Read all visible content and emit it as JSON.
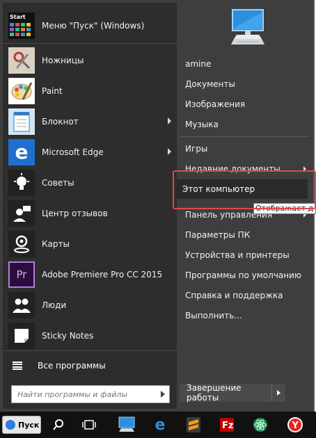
{
  "menu": {
    "header_item": {
      "label": "Меню \"Пуск\" (Windows)",
      "icon": "start-menu-tiles-icon",
      "tile_text": "Start"
    },
    "programs": [
      {
        "label": "Ножницы",
        "icon": "scissors-icon",
        "has_submenu": false
      },
      {
        "label": "Paint",
        "icon": "paint-palette-icon",
        "has_submenu": false
      },
      {
        "label": "Блокнот",
        "icon": "notepad-icon",
        "has_submenu": true
      },
      {
        "label": "Microsoft Edge",
        "icon": "edge-icon",
        "has_submenu": true
      },
      {
        "label": "Советы",
        "icon": "lightbulb-icon",
        "has_submenu": false
      },
      {
        "label": "Центр отзывов",
        "icon": "feedback-icon",
        "has_submenu": false
      },
      {
        "label": "Карты",
        "icon": "maps-icon",
        "has_submenu": false
      },
      {
        "label": "Adobe Premiere Pro CC 2015",
        "icon": "premiere-icon",
        "icon_text": "Pr",
        "has_submenu": false
      },
      {
        "label": "Люди",
        "icon": "people-icon",
        "has_submenu": false
      },
      {
        "label": "Sticky Notes",
        "icon": "sticky-notes-icon",
        "has_submenu": false
      }
    ],
    "all_programs": "Все программы",
    "search": {
      "placeholder": "Найти программы и файлы",
      "value": ""
    }
  },
  "right": {
    "items": [
      {
        "label": "amine",
        "has_submenu": false
      },
      {
        "label": "Документы",
        "has_submenu": false
      },
      {
        "label": "Изображения",
        "has_submenu": false
      },
      {
        "label": "Музыка",
        "has_submenu": false
      },
      {
        "label": "Игры",
        "has_submenu": false
      },
      {
        "label": "Недавние документы",
        "has_submenu": true
      },
      {
        "label": "Этот компьютер",
        "has_submenu": false,
        "selected": true
      },
      {
        "label": "Панель управления",
        "has_submenu": true
      },
      {
        "label": "Параметры ПК",
        "has_submenu": false
      },
      {
        "label": "Устройства и принтеры",
        "has_submenu": false
      },
      {
        "label": "Программы по умолчанию",
        "has_submenu": false
      },
      {
        "label": "Справка и поддержка",
        "has_submenu": false
      },
      {
        "label": "Выполнить...",
        "has_submenu": false
      }
    ],
    "tooltip": "Отображает д",
    "shutdown": "Завершение работы"
  },
  "taskbar": {
    "start_label": "Пуск",
    "icons": [
      "search-icon",
      "task-view-icon",
      "computer-icon",
      "edge-icon",
      "sublime-text-icon",
      "filezilla-icon",
      "atom-icon",
      "yandex-browser-icon"
    ]
  },
  "colors": {
    "accent": "#d94b4b",
    "menu_bg": "#3e3e3e",
    "left_bg": "#2d2d2d"
  }
}
